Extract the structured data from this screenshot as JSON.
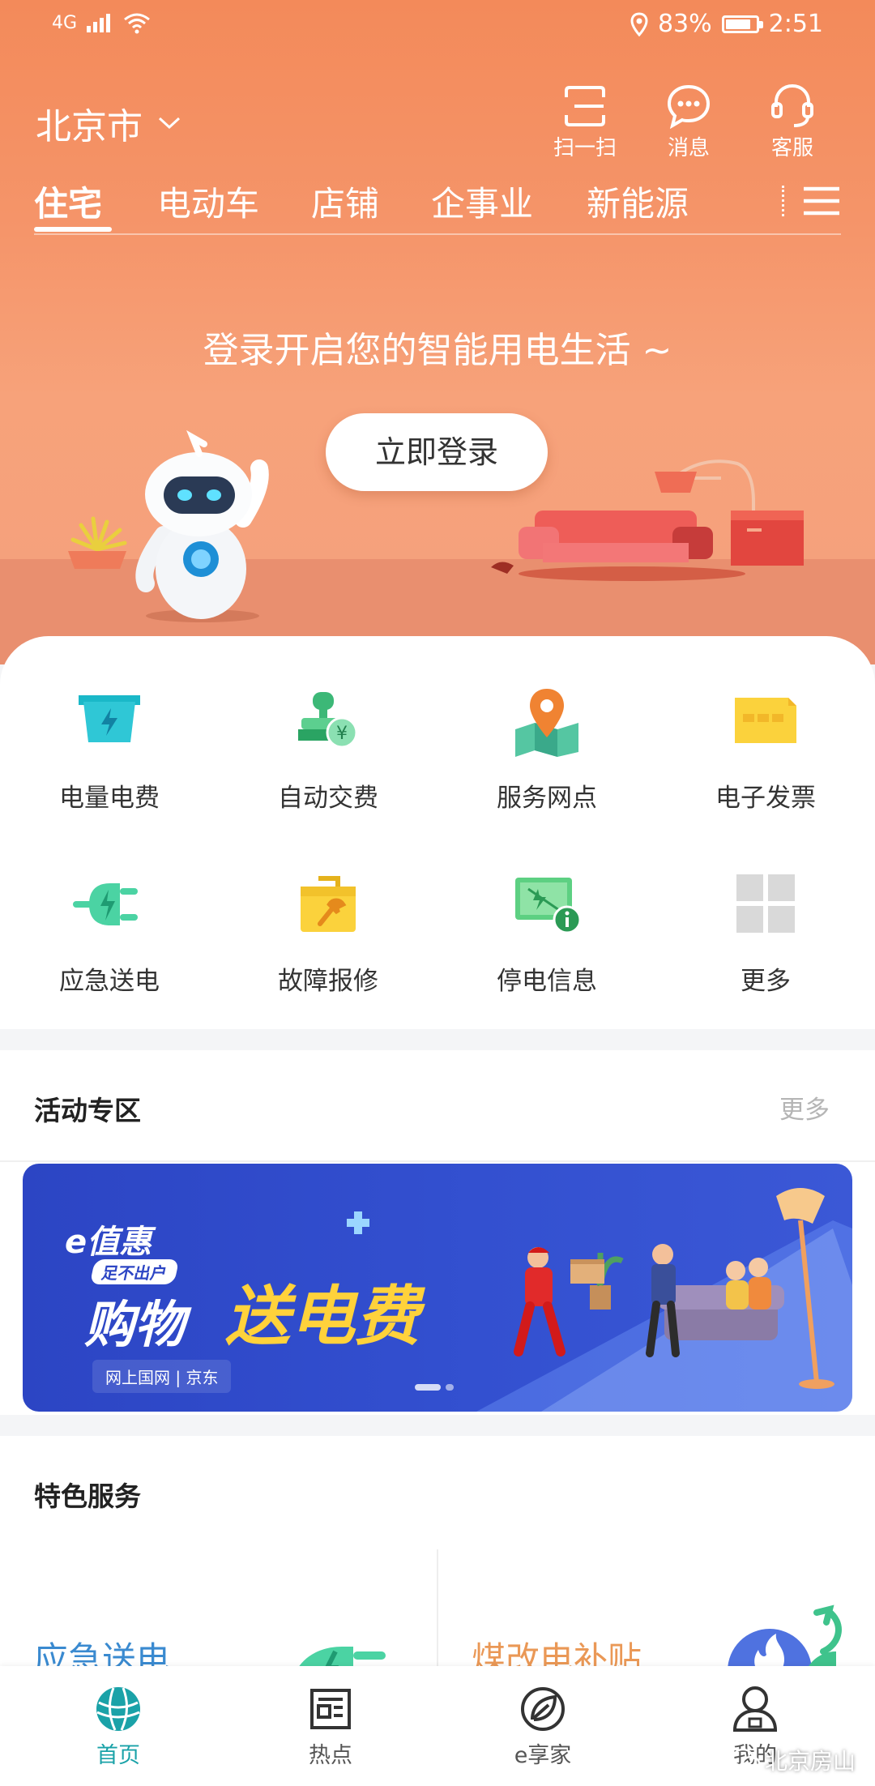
{
  "status_bar": {
    "signal": "4G",
    "battery_percent": "83%",
    "battery_level": 0.83,
    "time": "2:51"
  },
  "header": {
    "city": "北京市",
    "actions": [
      {
        "label": "扫一扫",
        "icon": "scan-icon"
      },
      {
        "label": "消息",
        "icon": "message-icon"
      },
      {
        "label": "客服",
        "icon": "headset-icon"
      }
    ]
  },
  "tabs": [
    "住宅",
    "电动车",
    "店铺",
    "企事业",
    "新能源"
  ],
  "active_tab": "住宅",
  "hero": {
    "headline": "登录开启您的智能用电生活 ~",
    "login_button": "立即登录"
  },
  "services": [
    {
      "label": "电量电费",
      "icon": "electricity-bill-icon"
    },
    {
      "label": "自动交费",
      "icon": "auto-pay-icon"
    },
    {
      "label": "服务网点",
      "icon": "service-point-icon"
    },
    {
      "label": "电子发票",
      "icon": "e-invoice-icon"
    },
    {
      "label": "应急送电",
      "icon": "emergency-power-icon"
    },
    {
      "label": "故障报修",
      "icon": "repair-icon"
    },
    {
      "label": "停电信息",
      "icon": "outage-info-icon"
    },
    {
      "label": "更多",
      "icon": "more-grid-icon"
    }
  ],
  "activity": {
    "title": "活动专区",
    "more": "更多",
    "banner": {
      "brand": "e值惠",
      "tag": "足不出户",
      "headline_white": "购物",
      "headline_yellow": "送电费",
      "partners": "网上国网 | 京东"
    }
  },
  "featured": {
    "title": "特色服务",
    "items": [
      "应急送电",
      "煤改电补贴"
    ]
  },
  "bottom_nav": [
    {
      "label": "首页",
      "icon": "home-globe-icon",
      "active": true
    },
    {
      "label": "热点",
      "icon": "news-icon",
      "active": false
    },
    {
      "label": "e享家",
      "icon": "leaf-icon",
      "active": false
    },
    {
      "label": "我的",
      "icon": "profile-icon",
      "active": false
    }
  ],
  "watermark": "北京房山",
  "colors": {
    "hero": "#f38a5a",
    "accent": "#1aa2a8",
    "banner": "#2c45c4"
  }
}
